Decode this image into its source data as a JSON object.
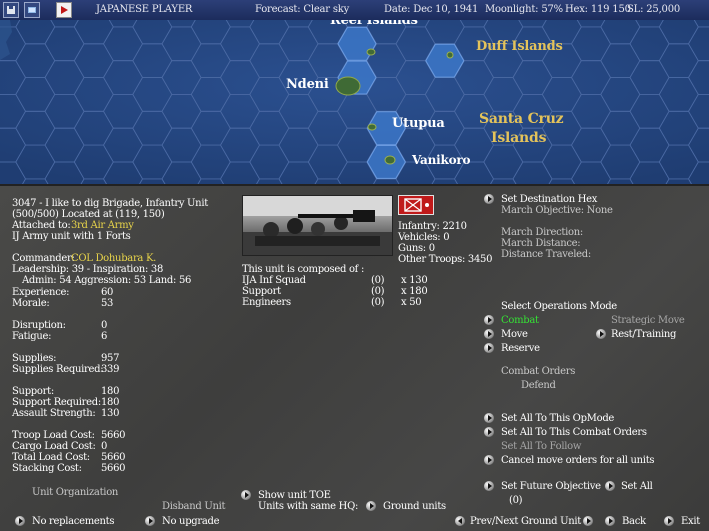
{
  "topbar": {
    "player": "JAPANESE PLAYER",
    "forecast": "Forecast: Clear sky",
    "date": "Date: Dec 10, 1941",
    "moonlight": "Moonlight: 57%",
    "hex": "Hex: 119  150",
    "sl": "SL: 25,000",
    "icons": [
      "disk-icon",
      "screen-icon",
      "play-icon"
    ]
  },
  "map": {
    "labels": {
      "reef": "Reef Islands",
      "duff": "Duff Islands",
      "ndeni": "Ndeni",
      "utupua": "Utupua",
      "santa_cruz_1": "Santa Cruz",
      "santa_cruz_2": "Islands",
      "vanikoro": "Vanikoro"
    },
    "colors": {
      "ocean": "#26457c",
      "highlight": "#3c77c8",
      "label_gold": "#e4c35a",
      "label_white": "#ffffff"
    }
  },
  "unit": {
    "line1": "3047 - I like to dig Brigade, Infantry Unit",
    "line2": "(500/500) Located at (119, 150)",
    "attached_label": "Attached to:",
    "attached_value": "3rd Air Army",
    "line4": "IJ Army unit with 1 Forts",
    "commander_label": "Commander:",
    "commander_value": "COL Dohubara K.",
    "leadership": "Leadership: 39 - Inspiration: 38",
    "admin": "Admin:  54  Aggression:  53  Land:  56",
    "stats": [
      {
        "label": "Experience:",
        "value": "60"
      },
      {
        "label": "Morale:",
        "value": "53"
      },
      {
        "label": "Disruption:",
        "value": "0"
      },
      {
        "label": "Fatigue:",
        "value": "6"
      },
      {
        "label": "Supplies:",
        "value": "957"
      },
      {
        "label": "Supplies Required:",
        "value": "339"
      },
      {
        "label": "Support:",
        "value": "180"
      },
      {
        "label": "Support Required:",
        "value": "180"
      },
      {
        "label": "Assault Strength:",
        "value": "130"
      },
      {
        "label": "Troop Load Cost:",
        "value": "5660"
      },
      {
        "label": "Cargo Load Cost:",
        "value": "0"
      },
      {
        "label": "Total Load Cost:",
        "value": "5660"
      },
      {
        "label": "Stacking Cost:",
        "value": "5660"
      }
    ]
  },
  "counts": {
    "infantry": "Infantry: 2210",
    "vehicles": "Vehicles: 0",
    "guns": "Guns: 0",
    "other": "Other Troops: 3450"
  },
  "composition": {
    "title": "This unit is composed of :",
    "rows": [
      {
        "name": "IJA Inf Squad",
        "avail": "(0)",
        "count": "x 130"
      },
      {
        "name": "Support",
        "avail": "(0)",
        "count": "x 180"
      },
      {
        "name": "Engineers",
        "avail": "(0)",
        "count": "x 50"
      }
    ]
  },
  "destination": {
    "set_label": "Set Destination Hex",
    "march_objective": "March Objective: None",
    "march_direction": "March Direction:",
    "march_distance": "March Distance:",
    "distance_traveled": "Distance Traveled:"
  },
  "opmode": {
    "title": "Select Operations Mode",
    "combat": "Combat",
    "strategic": "Strategic Move",
    "move": "Move",
    "rest": "Rest/Training",
    "reserve": "Reserve",
    "combat_orders": "Combat Orders",
    "defend": "Defend"
  },
  "actions": {
    "set_all_opmode": "Set All To This OpMode",
    "set_all_combat": "Set All To This Combat Orders",
    "set_all_follow": "Set All To Follow",
    "cancel_move": "Cancel move orders for all units",
    "set_future": "Set Future Objective",
    "set_all": "Set All",
    "future_value": "(0)"
  },
  "bottom": {
    "unit_org": "Unit Organization",
    "disband": "Disband Unit",
    "show_toe": "Show unit TOE",
    "same_hq": "Units with same HQ:",
    "ground_units": "Ground units",
    "no_replacements": "No replacements",
    "no_upgrade": "No upgrade",
    "prev_next": "Prev/Next Ground Unit",
    "back": "Back",
    "exit": "Exit"
  }
}
